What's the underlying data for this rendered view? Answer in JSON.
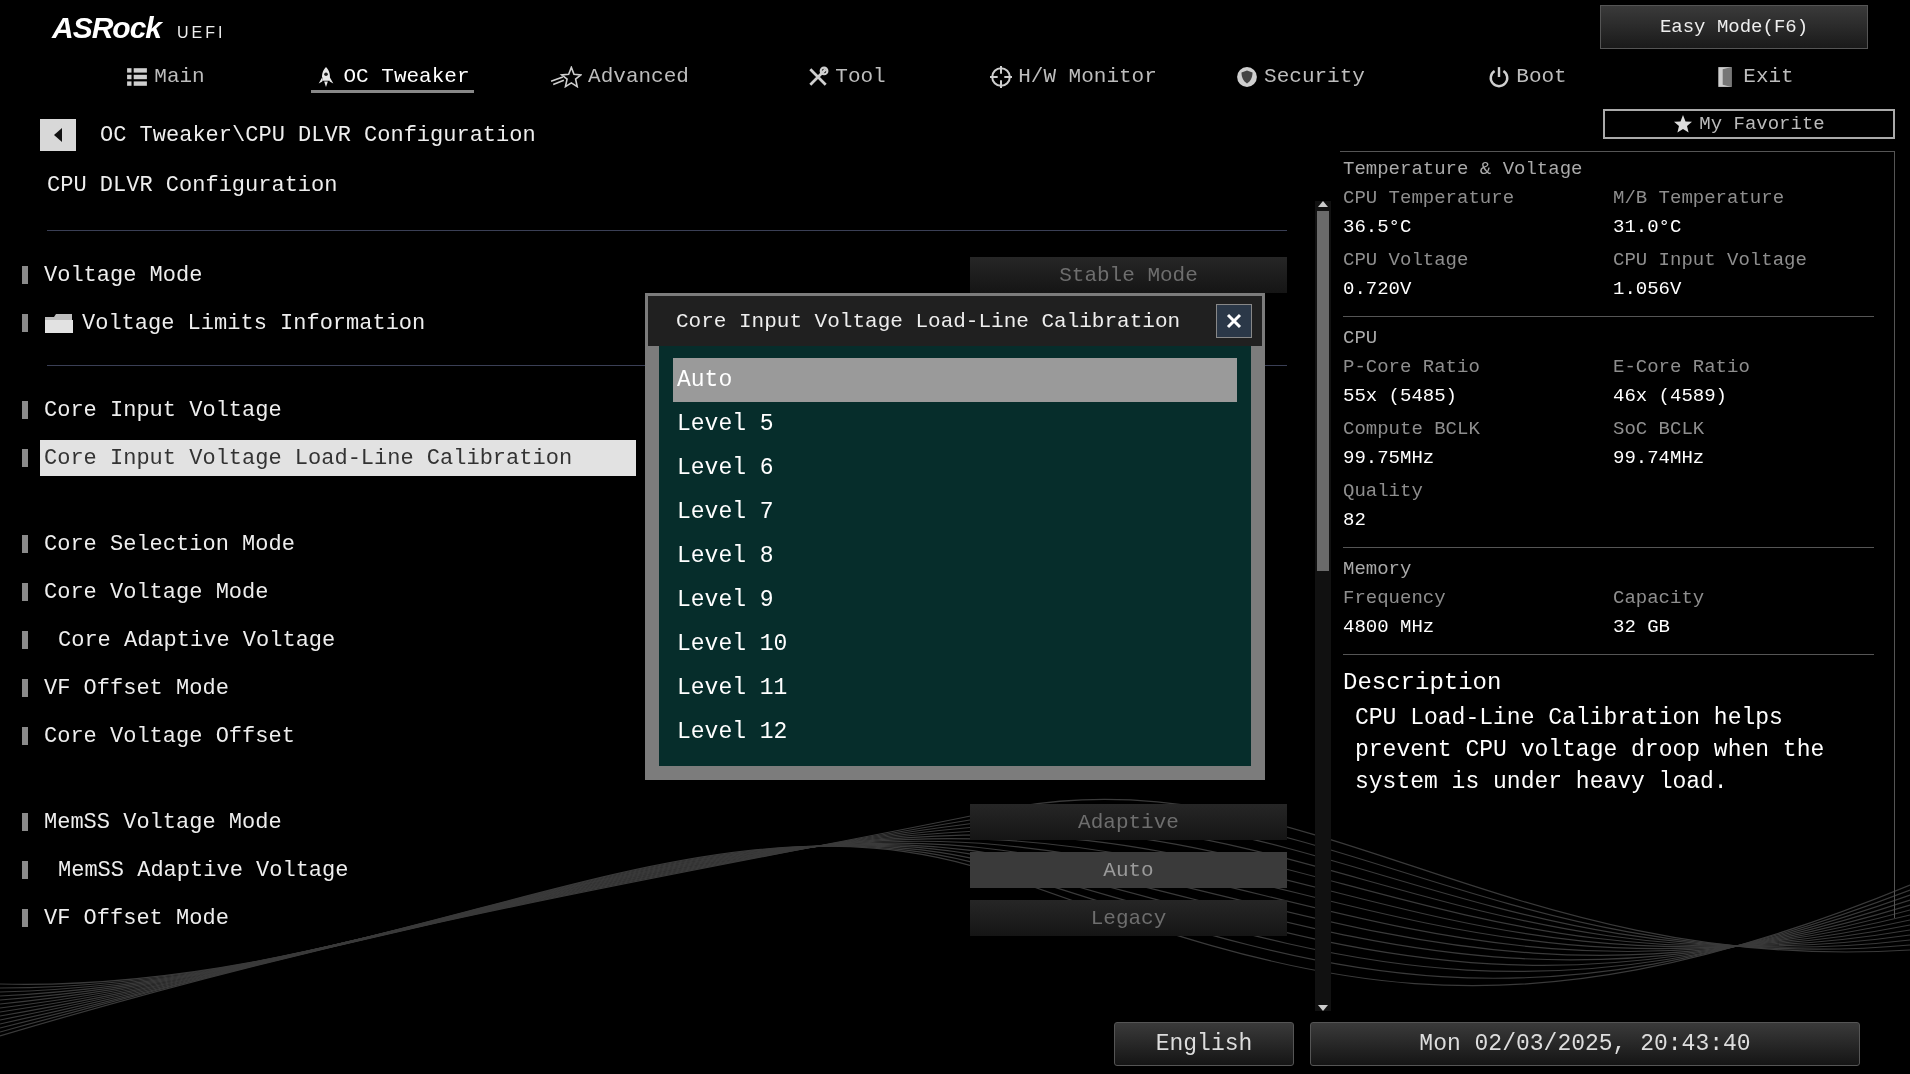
{
  "header": {
    "logo": "ASRock",
    "logo_sub": "UEFI",
    "easy_mode_button": "Easy Mode(F6)"
  },
  "tabs": [
    {
      "label": "Main",
      "selected": false
    },
    {
      "label": "OC Tweaker",
      "selected": true
    },
    {
      "label": "Advanced",
      "selected": false
    },
    {
      "label": "Tool",
      "selected": false
    },
    {
      "label": "H/W Monitor",
      "selected": false
    },
    {
      "label": "Security",
      "selected": false
    },
    {
      "label": "Boot",
      "selected": false
    },
    {
      "label": "Exit",
      "selected": false
    }
  ],
  "breadcrumb": "OC Tweaker\\CPU DLVR Configuration",
  "favorite_button": "My Favorite",
  "page_title": "CPU DLVR Configuration",
  "sections": [
    {
      "divider_after": true,
      "items": [
        {
          "kind": "setting",
          "label": "Voltage Mode",
          "selected": false,
          "value": {
            "text": "Stable Mode",
            "disabled": false
          }
        },
        {
          "kind": "folder",
          "label": "Voltage Limits Information",
          "selected": false
        }
      ]
    },
    {
      "divider_after": false,
      "items": [
        {
          "kind": "setting",
          "label": "Core Input Voltage",
          "selected": false
        },
        {
          "kind": "setting",
          "label": "Core Input Voltage Load-Line Calibration",
          "selected": true
        }
      ]
    },
    {
      "divider_after": false,
      "items": [
        {
          "kind": "setting",
          "label": "Core Selection Mode",
          "selected": false
        },
        {
          "kind": "setting",
          "label": "Core Voltage Mode",
          "selected": false,
          "children": [
            {
              "kind": "setting",
              "label": "Core Adaptive Voltage",
              "selected": false
            }
          ]
        },
        {
          "kind": "setting",
          "label": "VF Offset Mode",
          "selected": false
        },
        {
          "kind": "setting",
          "label": "Core Voltage Offset",
          "selected": false
        }
      ]
    },
    {
      "divider_after": false,
      "items": [
        {
          "kind": "setting",
          "label": "MemSS Voltage Mode",
          "selected": false,
          "value": {
            "text": "Adaptive",
            "disabled": false
          },
          "children": [
            {
              "kind": "setting",
              "label": "MemSS Adaptive Voltage",
              "selected": false,
              "value": {
                "text": "Auto",
                "disabled": true
              }
            }
          ]
        },
        {
          "kind": "setting",
          "label": "VF Offset Mode",
          "selected": false,
          "value": {
            "text": "Legacy",
            "disabled": false
          }
        }
      ]
    }
  ],
  "popup": {
    "title": "Core Input Voltage Load-Line Calibration",
    "options": [
      {
        "label": "Auto",
        "selected": true
      },
      {
        "label": "Level 5",
        "selected": false
      },
      {
        "label": "Level 6",
        "selected": false
      },
      {
        "label": "Level 7",
        "selected": false
      },
      {
        "label": "Level 8",
        "selected": false
      },
      {
        "label": "Level 9",
        "selected": false
      },
      {
        "label": "Level 10",
        "selected": false
      },
      {
        "label": "Level 11",
        "selected": false
      },
      {
        "label": "Level 12",
        "selected": false
      }
    ]
  },
  "info_panel": {
    "sections": [
      {
        "title": "Temperature & Voltage",
        "fields": [
          {
            "label": "CPU Temperature",
            "value": "36.5°C"
          },
          {
            "label": "M/B Temperature",
            "value": "31.0°C"
          },
          {
            "label": "CPU Voltage",
            "value": "0.720V"
          },
          {
            "label": "CPU Input Voltage",
            "value": "1.056V"
          }
        ]
      },
      {
        "title": "CPU",
        "fields": [
          {
            "label": "P-Core Ratio",
            "value": "55x (5485)"
          },
          {
            "label": "E-Core Ratio",
            "value": "46x (4589)"
          },
          {
            "label": "Compute BCLK",
            "value": "99.75MHz"
          },
          {
            "label": "SoC BCLK",
            "value": "99.74MHz"
          },
          {
            "label": "Quality",
            "value": "82"
          }
        ]
      },
      {
        "title": "Memory",
        "fields": [
          {
            "label": "Frequency",
            "value": "4800 MHz"
          },
          {
            "label": "Capacity",
            "value": "32 GB"
          }
        ]
      }
    ],
    "description_title": "Description",
    "description": "CPU Load-Line Calibration helps prevent CPU voltage droop when the system is under heavy load."
  },
  "footer": {
    "language": "English",
    "datetime": "Mon 02/03/2025, 20:43:40"
  }
}
